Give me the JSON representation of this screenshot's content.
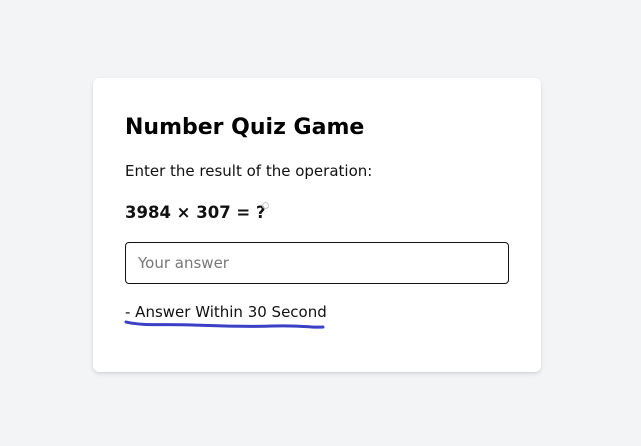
{
  "quiz": {
    "title": "Number Quiz Game",
    "prompt": "Enter the result of the operation:",
    "question": "3984 × 307 = ?",
    "answer": {
      "value": "",
      "placeholder": "Your answer"
    },
    "hint": "- Answer Within 30 Second"
  },
  "colors": {
    "page_background": "#f3f4f6",
    "card_background": "#ffffff",
    "annotation_underline": "#3a3fc4"
  }
}
